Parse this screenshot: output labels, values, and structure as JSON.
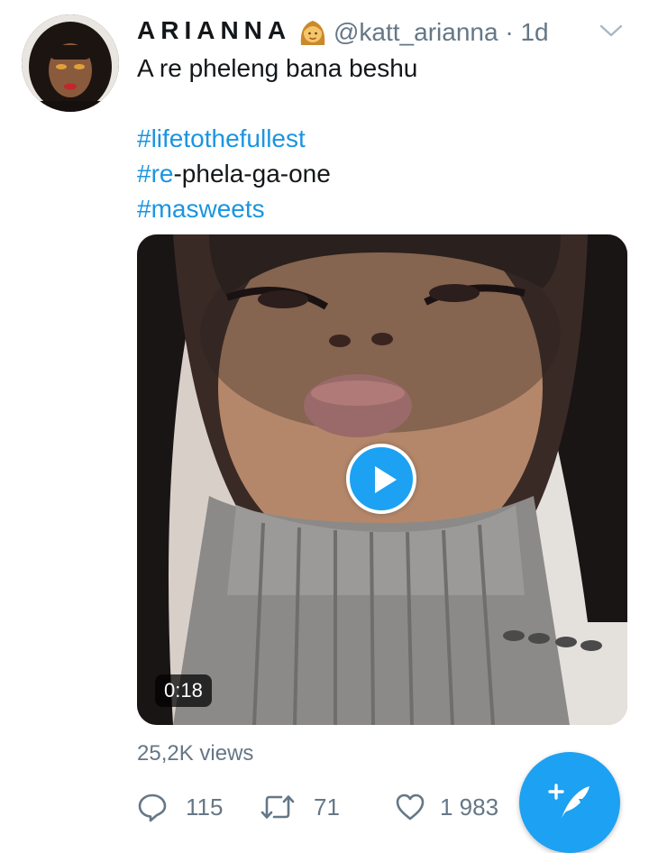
{
  "tweet": {
    "author": {
      "display_name": "ARIANNA",
      "name_emoji": "woman-emoji",
      "handle": "@katt_arianna",
      "separator": "·",
      "time": "1d"
    },
    "text": "A re pheleng bana beshu",
    "hashtags": [
      {
        "tag": "#lifetothefullest"
      },
      {
        "tag": "#re",
        "suffix": "-phela-ga-one"
      },
      {
        "tag": "#masweets"
      }
    ],
    "media": {
      "type": "video",
      "duration": "0:18",
      "play_icon": "play-icon"
    },
    "views": "25,2K views",
    "actions": {
      "reply_icon": "reply-icon",
      "reply_count": "115",
      "retweet_icon": "retweet-icon",
      "retweet_count": "71",
      "like_icon": "heart-icon",
      "like_count": "1 983"
    }
  },
  "compose_button": {
    "icon": "compose-tweet-icon"
  },
  "colors": {
    "accent": "#1da1f2",
    "hashtag": "#1b95e0",
    "secondary_text": "#657786",
    "primary_text": "#14171a"
  }
}
